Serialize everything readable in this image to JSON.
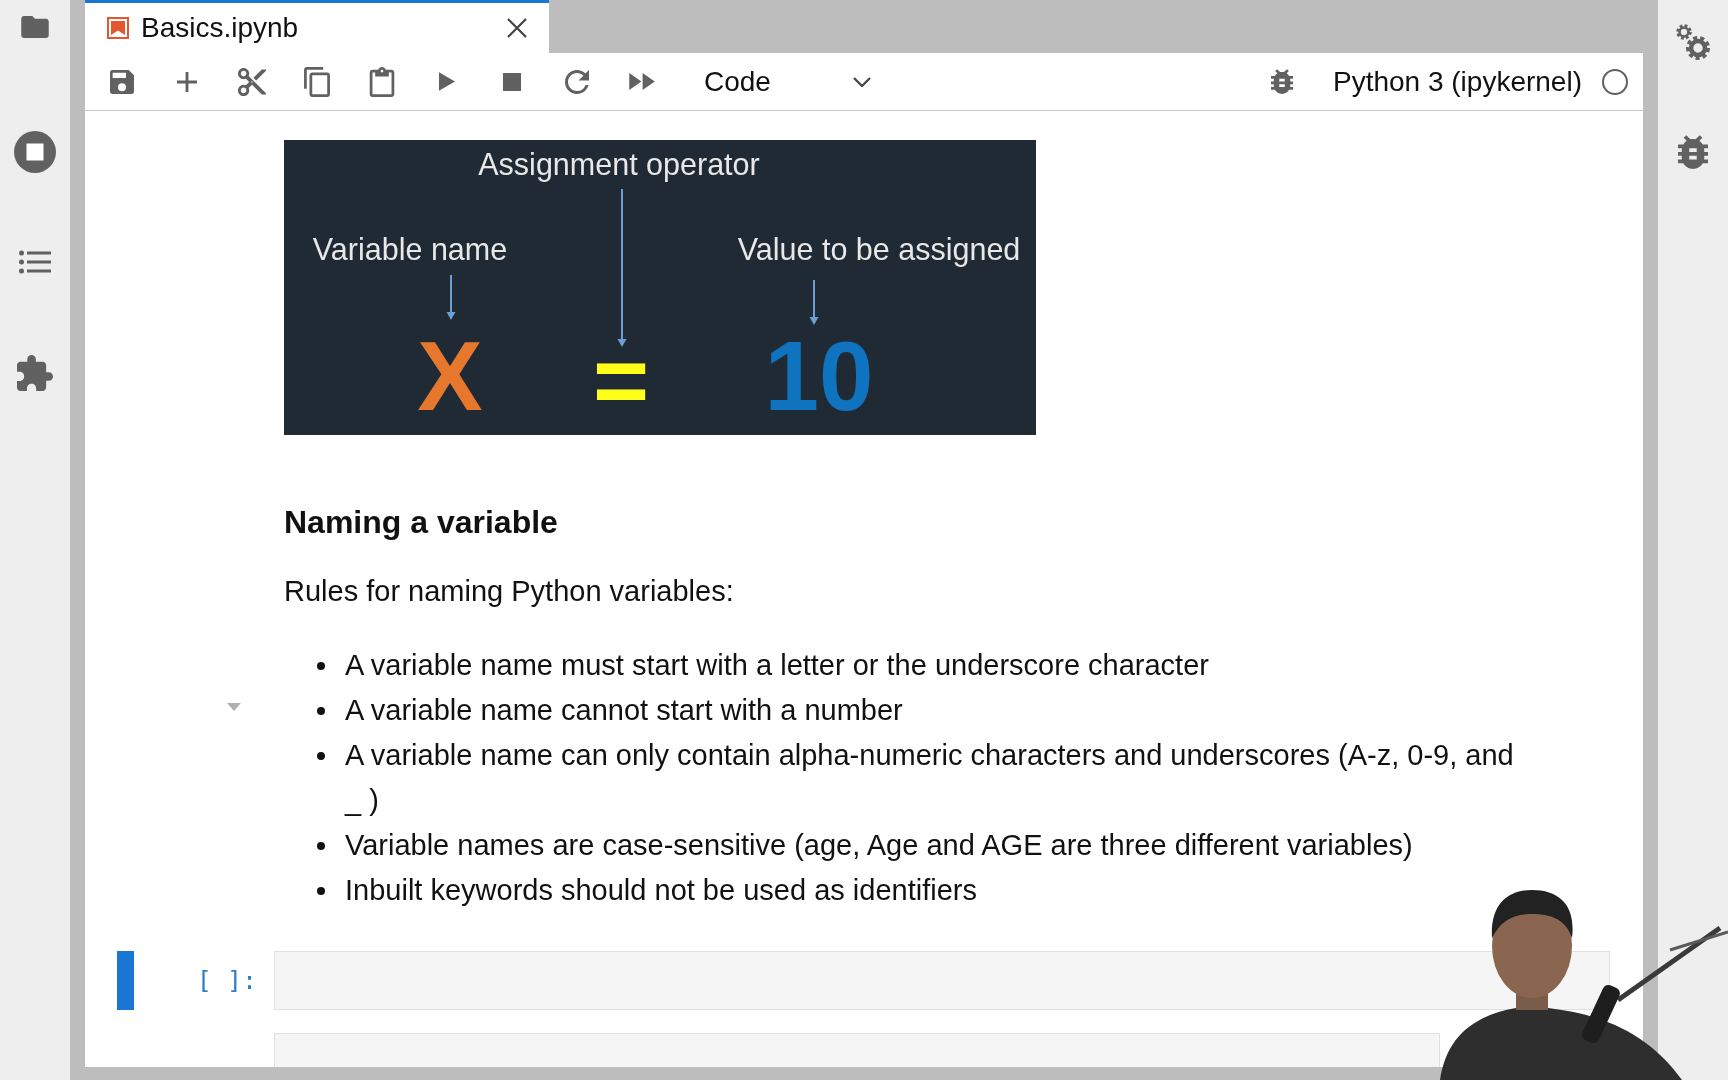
{
  "tabs": [
    {
      "label": "Basics.ipynb",
      "selected": true
    }
  ],
  "toolbar": {
    "cell_type": "Code",
    "kernel": "Python 3 (ipykernel)",
    "kernel_busy": false
  },
  "cells": [
    {
      "kind": "markdown",
      "figure": {
        "title": "Assignment operator",
        "left_label": "Variable name",
        "right_label": "Value to be assigned",
        "variable": "X",
        "operator": "=",
        "value": "10"
      },
      "heading": "Naming a variable",
      "text": "Rules for naming Python variables:",
      "bullets": [
        "A variable name must start with a letter or the underscore character",
        "A variable name cannot start with a number",
        "A variable name can only contain alpha-numeric characters and underscores (A-z, 0-9, and _ )",
        "Variable names are case-sensitive (age, Age and AGE are three different variables)",
        "Inbuilt keywords should not be used as identifiers"
      ]
    },
    {
      "kind": "code",
      "prompt": "[ ]:",
      "selected": true
    },
    {
      "kind": "code",
      "selected": false
    }
  ]
}
